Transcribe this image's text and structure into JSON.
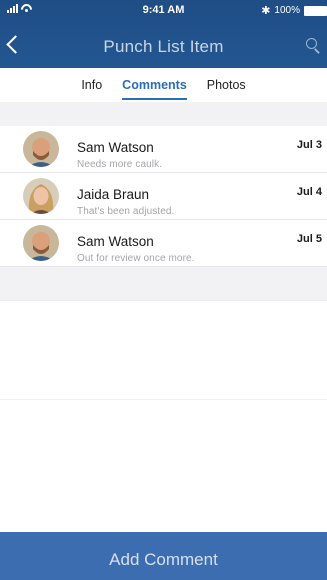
{
  "status_bar": {
    "time": "9:41 AM",
    "battery": "100%"
  },
  "nav": {
    "title": "Punch List Item"
  },
  "tabs": [
    {
      "label": "Info",
      "active": false
    },
    {
      "label": "Comments",
      "active": true
    },
    {
      "label": "Photos",
      "active": false
    }
  ],
  "comments": [
    {
      "name": "Sam Watson",
      "text": "Needs more caulk.",
      "date": "Jul 3",
      "avatar": "man-avatar"
    },
    {
      "name": "Jaida Braun",
      "text": "That's been adjusted.",
      "date": "Jul 4",
      "avatar": "woman-avatar"
    },
    {
      "name": "Sam Watson",
      "text": "Out for review once more.",
      "date": "Jul 5",
      "avatar": "man-avatar"
    }
  ],
  "footer": {
    "add_comment_label": "Add Comment"
  },
  "colors": {
    "header_blue": "#235792",
    "accent_blue": "#2a6db8",
    "button_blue": "#3b6db0"
  }
}
